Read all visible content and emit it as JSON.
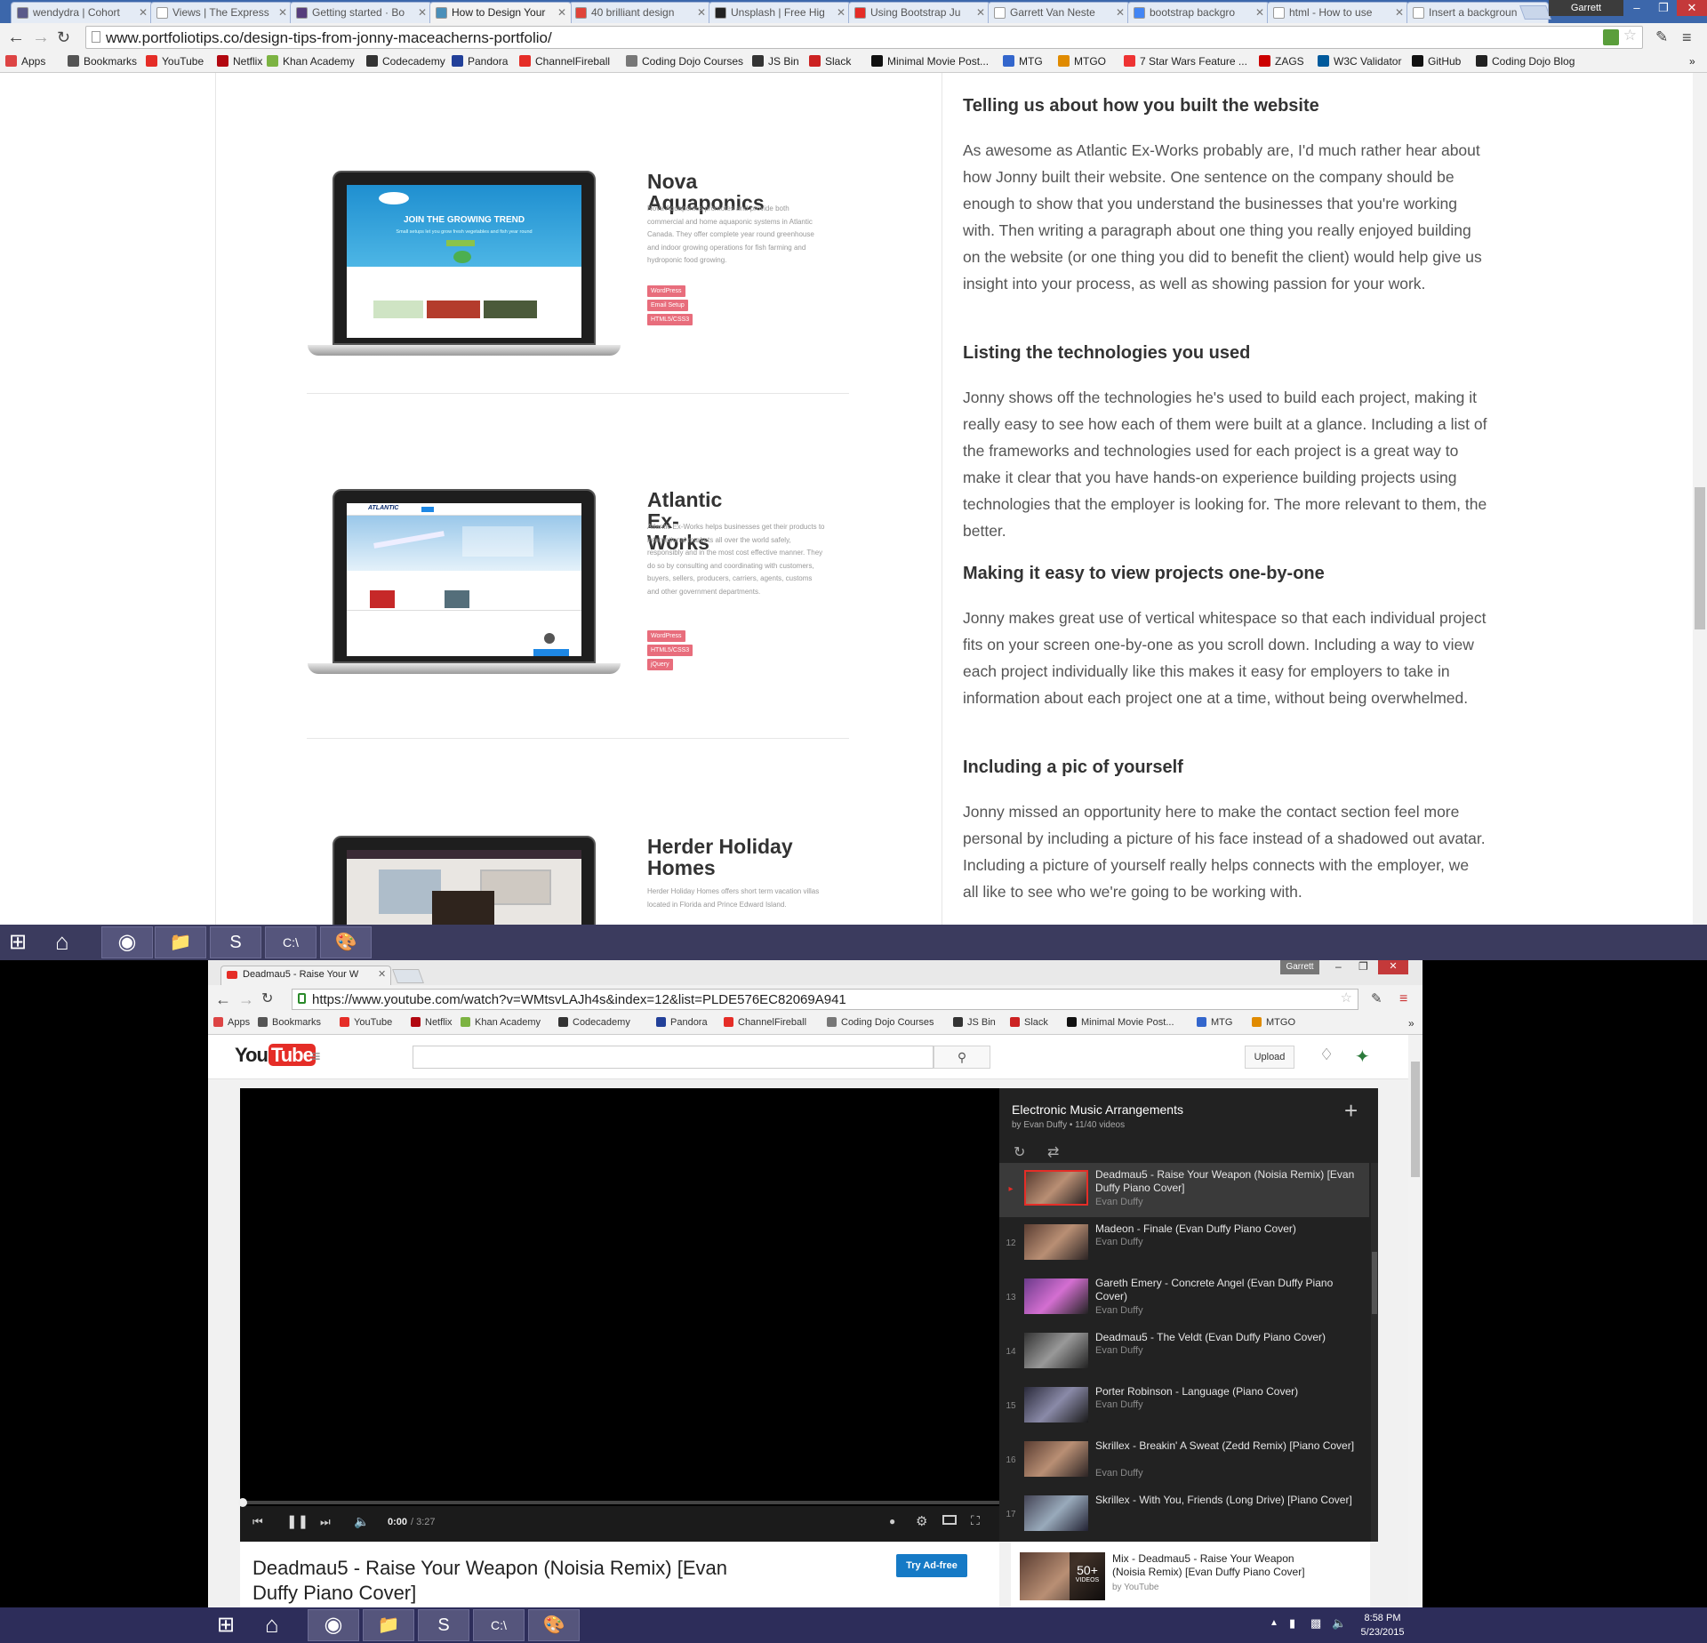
{
  "top_browser": {
    "tabs": [
      {
        "label": "wendydra | Cohort",
        "color": "#5a5a8a"
      },
      {
        "label": "Views | The Express",
        "color": "#ffffff"
      },
      {
        "label": "Getting started · Bo",
        "color": "#563d7c"
      },
      {
        "label": "How to Design Your",
        "color": "#4a8fb9"
      },
      {
        "label": "40 brilliant design",
        "color": "#e0443a"
      },
      {
        "label": "Unsplash | Free Hig",
        "color": "#222222"
      },
      {
        "label": "Using Bootstrap Ju",
        "color": "#e52d27"
      },
      {
        "label": "Garrett Van Neste",
        "color": "#ffffff"
      },
      {
        "label": "bootstrap backgro",
        "color": "#4285f4"
      },
      {
        "label": "html - How to use",
        "color": "#ffffff"
      },
      {
        "label": "Insert a backgroun",
        "color": "#ffffff"
      }
    ],
    "user": "Garrett",
    "url": "www.portfoliotips.co/design-tips-from-jonny-maceacherns-portfolio/",
    "bookmarks": [
      {
        "label": "Apps",
        "color": "#d44"
      },
      {
        "label": "Bookmarks",
        "color": "#555"
      },
      {
        "label": "YouTube",
        "color": "#e52d27"
      },
      {
        "label": "Netflix",
        "color": "#b20710"
      },
      {
        "label": "Khan Academy",
        "color": "#7cb342"
      },
      {
        "label": "Codecademy",
        "color": "#333"
      },
      {
        "label": "Pandora",
        "color": "#224099"
      },
      {
        "label": "ChannelFireball",
        "color": "#e52d27"
      },
      {
        "label": "Coding Dojo Courses",
        "color": "#777"
      },
      {
        "label": "JS Bin",
        "color": "#333"
      },
      {
        "label": "Slack",
        "color": "#c22"
      },
      {
        "label": "Minimal Movie Post...",
        "color": "#111"
      },
      {
        "label": "MTG",
        "color": "#36c"
      },
      {
        "label": "MTGO",
        "color": "#e08b00"
      },
      {
        "label": "7 Star Wars Feature ...",
        "color": "#e33"
      },
      {
        "label": "ZAGS",
        "color": "#c00"
      },
      {
        "label": "W3C Validator",
        "color": "#005a9c"
      },
      {
        "label": "GitHub",
        "color": "#111"
      },
      {
        "label": "Coding Dojo Blog",
        "color": "#222"
      }
    ]
  },
  "projects": [
    {
      "title": "Nova Aquaponics",
      "desc": "Nova Aquaponics promotes and provide both commercial and home aquaponic systems in Atlantic Canada. They offer complete year round greenhouse and indoor growing operations for fish farming and hydroponic food growing.",
      "tags": [
        "WordPress",
        "Email Setup",
        "HTML5/CSS3"
      ],
      "screen_headline": "JOIN THE GROWING TREND",
      "screen_sub": "Small setups let you grow fresh vegetables and fish year round"
    },
    {
      "title": "Atlantic Ex-Works",
      "desc": "Atlantic Ex-Works helps businesses get their products to international markets all over the world safely, responsibly and in the most cost effective manner. They do so by consulting and coordinating with customers, buyers, sellers, producers, carriers, agents, customs and other government departments.",
      "tags": [
        "WordPress",
        "HTML5/CSS3",
        "jQuery"
      ],
      "screen_headline": "ATLANTIC"
    },
    {
      "title": "Herder Holiday Homes",
      "desc": "Herder Holiday Homes offers short term vacation villas located in Florida and Prince Edward Island.",
      "tags": []
    }
  ],
  "article": [
    {
      "heading": "Telling us about how you built the website",
      "text": "As awesome as Atlantic Ex-Works probably are, I'd much rather hear about how Jonny built their website. One sentence on the company should be enough to show that you understand the businesses that you're working with. Then writing a paragraph about one thing you really enjoyed building on the website (or one thing you did to benefit the client) would help give us insight into your process, as well as showing passion for your work."
    },
    {
      "heading": "Listing the technologies you used",
      "text": "Jonny shows off the technologies he's used to build each project, making it really easy to see how each of them were built at a glance. Including a list of the frameworks and technologies used for each project is a great way to make it clear that you have hands-on experience building projects using technologies that the employer is looking for. The more relevant to them, the better."
    },
    {
      "heading": "Making it easy to view projects one-by-one",
      "text": "Jonny makes great use of vertical whitespace so that each individual project fits on your screen one-by-one as you scroll down. Including a way to view each project individually like this makes it easy for employers to take in information about each project one at a time, without being overwhelmed."
    },
    {
      "heading": "Including a pic of yourself",
      "text": "Jonny missed an opportunity here to make the contact section feel more personal by including a picture of his face instead of a shadowed out avatar. Including a picture of yourself really helps connects with the employer, we all like to see who we're going to be working with."
    }
  ],
  "bottom_browser": {
    "tab_label": "Deadmau5 - Raise Your W",
    "user": "Garrett",
    "url": "https://www.youtube.com/watch?v=WMtsvLAJh4s&index=12&list=PLDE576EC82069A941",
    "bookmarks": [
      "Apps",
      "Bookmarks",
      "YouTube",
      "Netflix",
      "Khan Academy",
      "Codecademy",
      "Pandora",
      "ChannelFireball",
      "Coding Dojo Courses",
      "JS Bin",
      "Slack",
      "Minimal Movie Post...",
      "MTG",
      "MTGO"
    ]
  },
  "youtube": {
    "logo_you": "You",
    "logo_tube": "Tube",
    "search_placeholder": "",
    "upload": "Upload",
    "playlist_title": "Electronic Music Arrangements",
    "playlist_meta": "by Evan Duffy • 11/40 videos",
    "playlist_items": [
      {
        "num": "▸",
        "title": "Deadmau5 - Raise Your Weapon (Noisia Remix) [Evan Duffy Piano Cover]",
        "by": "Evan Duffy",
        "active": true
      },
      {
        "num": "12",
        "title": "Madeon - Finale (Evan Duffy Piano Cover)",
        "by": "Evan Duffy"
      },
      {
        "num": "13",
        "title": "Gareth Emery - Concrete Angel (Evan Duffy Piano Cover)",
        "by": "Evan Duffy"
      },
      {
        "num": "14",
        "title": "Deadmau5 - The Veldt (Evan Duffy Piano Cover)",
        "by": "Evan Duffy"
      },
      {
        "num": "15",
        "title": "Porter Robinson - Language (Piano Cover)",
        "by": "Evan Duffy"
      },
      {
        "num": "16",
        "title": "Skrillex - Breakin' A Sweat (Zedd Remix) [Piano Cover]",
        "by": "Evan Duffy"
      },
      {
        "num": "17",
        "title": "Skrillex - With You, Friends (Long Drive) [Piano Cover]",
        "by": ""
      }
    ],
    "time_current": "0:00",
    "time_total": "/ 3:27",
    "progress_fraction": 0,
    "video_title": "Deadmau5 - Raise Your Weapon (Noisia Remix) [Evan Duffy Piano Cover]",
    "ad_free": "Try Ad-free",
    "related_title": "Mix - Deadmau5 - Raise Your Weapon (Noisia Remix) [Evan Duffy Piano Cover]",
    "related_by": "by YouTube",
    "related_badge": "50+",
    "related_badge_sub": "VIDEOS"
  },
  "taskbar": {
    "clock_time": "8:58 PM",
    "clock_date": "5/23/2015"
  }
}
